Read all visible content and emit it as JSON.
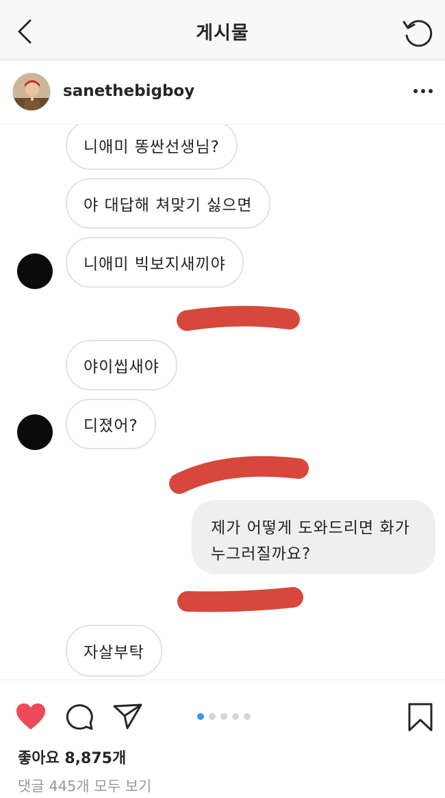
{
  "nav": {
    "title": "게시물",
    "back_icon": "chevron-left-icon",
    "refresh_icon": "refresh-icon"
  },
  "post": {
    "username": "sanethebigboy",
    "more_icon": "more-horizontal-icon"
  },
  "chat": {
    "messages": [
      {
        "side": "in",
        "text": "니애미 똥싼선생님?"
      },
      {
        "side": "in",
        "text": "야 대답해 쳐맞기 싫으면"
      },
      {
        "side": "in",
        "text": "니애미 빅보지새끼야"
      },
      {
        "side": "redacted"
      },
      {
        "side": "in",
        "text": "야이씹새야"
      },
      {
        "side": "in",
        "text": "디졌어?"
      },
      {
        "side": "redacted"
      },
      {
        "side": "out",
        "line1": "제가 어떻게 도와드리면 화가",
        "line2": "누그러질까요?"
      },
      {
        "side": "redacted"
      },
      {
        "side": "in",
        "text": "자살부탁"
      }
    ],
    "redaction_color": "#d7473b"
  },
  "actions": {
    "like_icon": "heart-filled-icon",
    "comment_icon": "comment-icon",
    "share_icon": "send-icon",
    "save_icon": "bookmark-icon",
    "like_color": "#ed4956",
    "carousel_current": 1,
    "carousel_total": 5
  },
  "likes_text": "좋아요 8,875개",
  "comments_text": "댓글 445개 모두 보기"
}
